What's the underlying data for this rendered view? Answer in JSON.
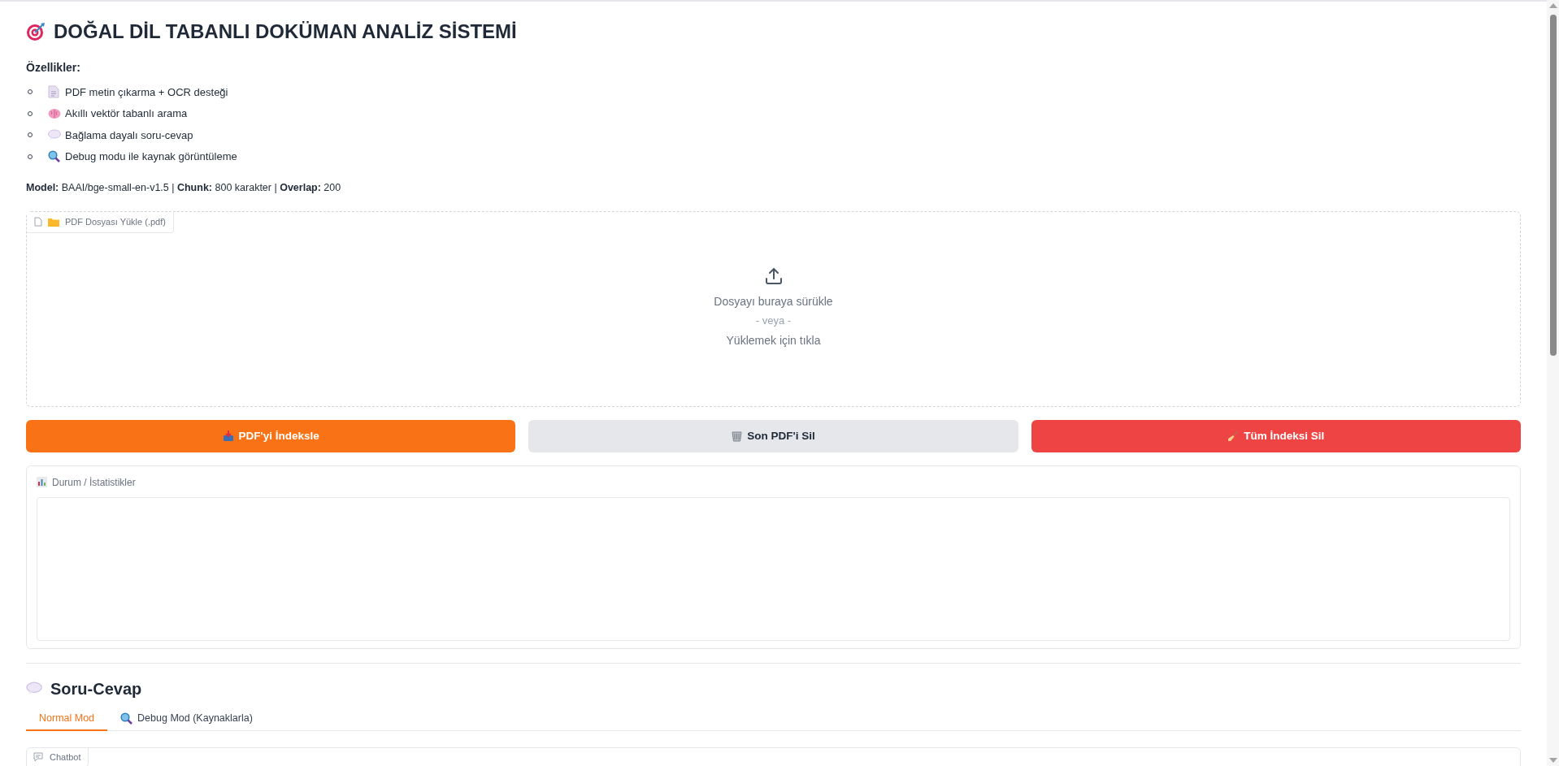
{
  "title": "DOĞAL DİL TABANLI DOKÜMAN ANALİZ SİSTEMİ",
  "features_heading": "Özellikler:",
  "features": [
    {
      "kind": "document",
      "text": "PDF metin çıkarma + OCR desteği"
    },
    {
      "kind": "brain",
      "text": "Akıllı vektör tabanlı arama"
    },
    {
      "kind": "speech",
      "text": "Bağlama dayalı soru-cevap"
    },
    {
      "kind": "search",
      "text": "Debug modu ile kaynak görüntüleme"
    }
  ],
  "model_info": "**Model:** BAAI/bge-small-en-v1.5 | **Chunk:** 800 karakter | **Overlap:** 200",
  "upload": {
    "label": "PDF Dosyası Yükle (.pdf)",
    "drop_text": "Dosyayı buraya sürükle",
    "or_text": "- veya -",
    "click_text": "Yüklemek için tıkla"
  },
  "buttons": [
    {
      "kind": "primary",
      "label": "PDF'yi İndeksle"
    },
    {
      "kind": "secondary",
      "label": "Son PDF'i Sil"
    },
    {
      "kind": "stop",
      "label": "Tüm İndeksi Sil"
    }
  ],
  "status": {
    "label": "Durum / İstatistikler"
  },
  "qa_heading": "Soru-Cevap",
  "tabs": [
    {
      "label": "Normal Mod",
      "selected": true
    },
    {
      "label": "Debug Mod (Kaynaklarla)",
      "selected": false
    }
  ],
  "chatbot": {
    "label": "Chatbot"
  }
}
